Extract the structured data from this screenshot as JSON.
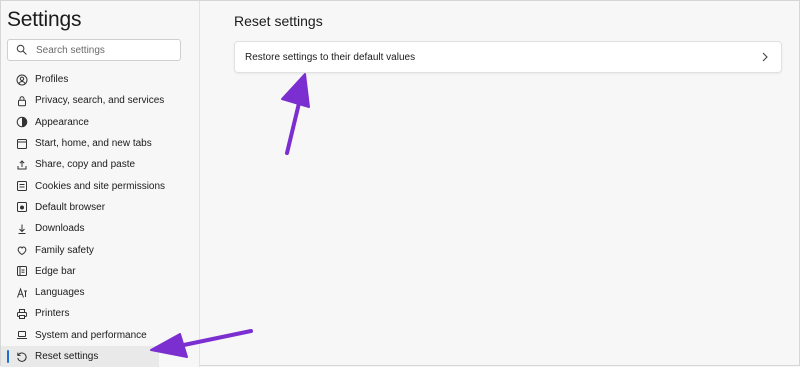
{
  "sidebar": {
    "title": "Settings",
    "search": {
      "placeholder": "Search settings"
    },
    "items": [
      {
        "label": "Profiles",
        "icon": "profile-icon"
      },
      {
        "label": "Privacy, search, and services",
        "icon": "lock-icon"
      },
      {
        "label": "Appearance",
        "icon": "appearance-icon"
      },
      {
        "label": "Start, home, and new tabs",
        "icon": "home-icon"
      },
      {
        "label": "Share, copy and paste",
        "icon": "share-icon"
      },
      {
        "label": "Cookies and site permissions",
        "icon": "cookies-icon"
      },
      {
        "label": "Default browser",
        "icon": "browser-icon"
      },
      {
        "label": "Downloads",
        "icon": "download-icon"
      },
      {
        "label": "Family safety",
        "icon": "family-icon"
      },
      {
        "label": "Edge bar",
        "icon": "edge-bar-icon"
      },
      {
        "label": "Languages",
        "icon": "languages-icon"
      },
      {
        "label": "Printers",
        "icon": "printer-icon"
      },
      {
        "label": "System and performance",
        "icon": "laptop-icon"
      },
      {
        "label": "Reset settings",
        "icon": "reset-icon",
        "active": true
      }
    ]
  },
  "main": {
    "title": "Reset settings",
    "restore_label": "Restore settings to their default values"
  },
  "colors": {
    "accent": "#1f6fd1",
    "annotation_arrow": "#7b2fd0"
  }
}
